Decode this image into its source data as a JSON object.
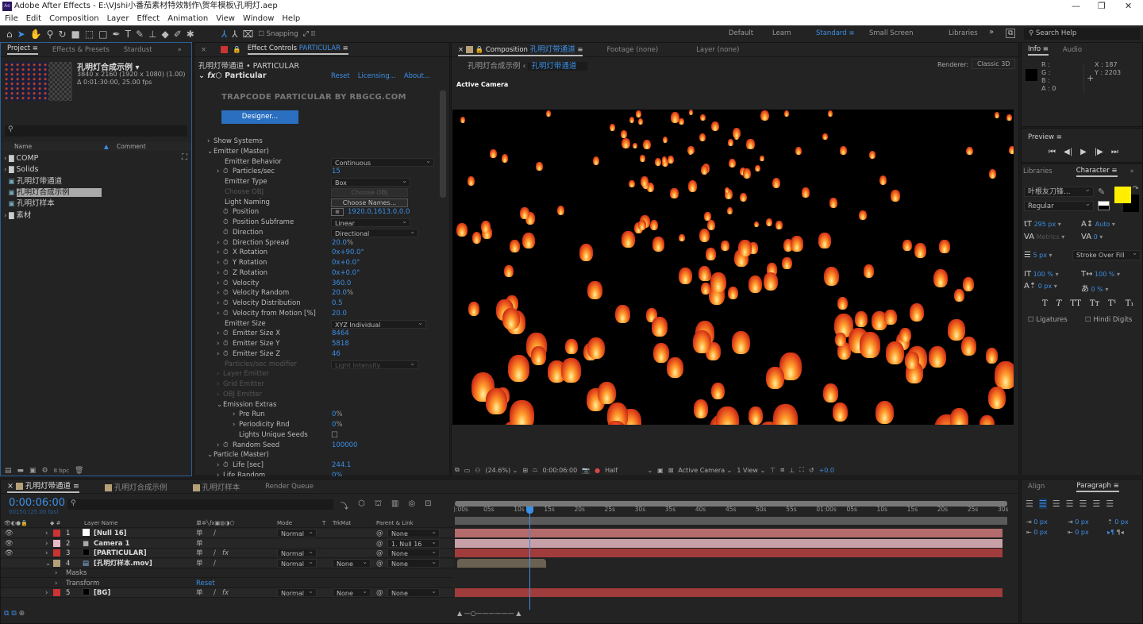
{
  "app": {
    "title": "Adobe After Effects - E:\\VJshi小番茄素材特效制作\\贺年模板\\孔明灯.aep",
    "logo": "Ae"
  },
  "menu": [
    "File",
    "Edit",
    "Composition",
    "Layer",
    "Effect",
    "Animation",
    "View",
    "Window",
    "Help"
  ],
  "toolbar": {
    "snapping": "Snapping",
    "workspaces": [
      "Default",
      "Learn",
      "Standard",
      "Small Screen",
      "Libraries"
    ],
    "active_workspace": "Standard",
    "search_placeholder": "Search Help"
  },
  "project": {
    "tabs": [
      "Project",
      "Effects & Presets",
      "Stardust"
    ],
    "comp_name": "孔明灯合成示例 ▾",
    "comp_size": "3840 x 2160  (1920 x 1080) (1.00)",
    "comp_duration": "Δ 0:01:30:00, 25.00 fps",
    "col_name": "Name",
    "col_comment": "Comment",
    "items": [
      {
        "name": "COMP",
        "type": "folder"
      },
      {
        "name": "Solids",
        "type": "folder"
      },
      {
        "name": "孔明灯带通道",
        "type": "comp"
      },
      {
        "name": "孔明灯合成示例",
        "type": "comp",
        "selected": true
      },
      {
        "name": "孔明灯样本",
        "type": "comp"
      },
      {
        "name": "素材",
        "type": "folder"
      }
    ],
    "bpc": "8 bpc"
  },
  "effect_controls": {
    "tab": "Effect Controls",
    "tab_layer": "PARTICULAR",
    "header": "孔明灯带通道 • PARTICULAR",
    "effect": "Particular",
    "links": [
      "Reset",
      "Licensing...",
      "About..."
    ],
    "brand": "TRAPCODE PARTICULAR BY RBGCG.COM",
    "designer": "Designer...",
    "rows": [
      {
        "label": "Show Systems",
        "ind": 0,
        "tw": ">"
      },
      {
        "label": "Emitter (Master)",
        "ind": 0,
        "tw": "v"
      },
      {
        "label": "Emitter Behavior",
        "ind": 2,
        "dd": "Continuous"
      },
      {
        "label": "Particles/sec",
        "ind": 1,
        "sw": true,
        "tw": ">",
        "val": "15"
      },
      {
        "label": "Emitter Type",
        "ind": 2,
        "dd": "Box"
      },
      {
        "label": "Choose OBJ",
        "ind": 2,
        "dis": true,
        "btn": "Choose OBJ"
      },
      {
        "label": "Light Naming",
        "ind": 2,
        "btn": "Choose Names..."
      },
      {
        "label": "Position",
        "ind": 1,
        "sw": true,
        "val": "1920.0,1613.0,0.0",
        "pos": true
      },
      {
        "label": "Position Subframe",
        "ind": 1,
        "sw": true,
        "dd": "Linear"
      },
      {
        "label": "Direction",
        "ind": 1,
        "sw": true,
        "dd": "Directional"
      },
      {
        "label": "Direction Spread",
        "ind": 1,
        "sw": true,
        "tw": ">",
        "val": "20.0",
        "unit": "%"
      },
      {
        "label": "X Rotation",
        "ind": 1,
        "sw": true,
        "tw": ">",
        "val": "0x+90.0°"
      },
      {
        "label": "Y Rotation",
        "ind": 1,
        "sw": true,
        "tw": ">",
        "val": "0x+0.0°"
      },
      {
        "label": "Z Rotation",
        "ind": 1,
        "sw": true,
        "tw": ">",
        "val": "0x+0.0°"
      },
      {
        "label": "Velocity",
        "ind": 1,
        "sw": true,
        "tw": ">",
        "val": "360.0"
      },
      {
        "label": "Velocity Random",
        "ind": 1,
        "sw": true,
        "tw": ">",
        "val": "20.0",
        "unit": "%"
      },
      {
        "label": "Velocity Distribution",
        "ind": 1,
        "sw": true,
        "tw": ">",
        "val": "0.5"
      },
      {
        "label": "Velocity from Motion [%]",
        "ind": 1,
        "sw": true,
        "tw": ">",
        "val": "20.0"
      },
      {
        "label": "Emitter Size",
        "ind": 2,
        "dd": "XYZ Individual"
      },
      {
        "label": "Emitter Size X",
        "ind": 1,
        "sw": true,
        "tw": ">",
        "val": "8464"
      },
      {
        "label": "Emitter Size Y",
        "ind": 1,
        "sw": true,
        "tw": ">",
        "val": "5818"
      },
      {
        "label": "Emitter Size Z",
        "ind": 1,
        "sw": true,
        "tw": ">",
        "val": "46"
      },
      {
        "label": "Particles/sec modifier",
        "ind": 2,
        "dis": true,
        "dd": "Light Intensity"
      },
      {
        "label": "Layer Emitter",
        "ind": 1,
        "dis": true,
        "tw": ">"
      },
      {
        "label": "Grid Emitter",
        "ind": 1,
        "dis": true,
        "tw": ">"
      },
      {
        "label": "OBJ Emitter",
        "ind": 1,
        "dis": true,
        "tw": ">"
      },
      {
        "label": "Emission Extras",
        "ind": 1,
        "tw": "v"
      },
      {
        "label": "Pre Run",
        "ind": 3,
        "tw": ">",
        "val": "0",
        "unit": "%"
      },
      {
        "label": "Periodicity Rnd",
        "ind": 3,
        "tw": ">",
        "val": "0",
        "unit": "%"
      },
      {
        "label": "Lights Unique Seeds",
        "ind": 3,
        "check": true
      },
      {
        "label": "Random Seed",
        "ind": 1,
        "sw": true,
        "tw": ">",
        "val": "100000"
      },
      {
        "label": "Particle (Master)",
        "ind": 0,
        "tw": "v"
      },
      {
        "label": "Life [sec]",
        "ind": 1,
        "sw": true,
        "tw": ">",
        "val": "244.1"
      },
      {
        "label": "Life Random",
        "ind": 1,
        "tw": ">",
        "val": "0%"
      }
    ]
  },
  "composition": {
    "tab_prefix": "Composition",
    "tab_name": "孔明灯带通道",
    "other_tabs": [
      "Footage (none)",
      "Layer (none)"
    ],
    "breadcrumb": [
      "孔明灯合成示例",
      "孔明灯带通道"
    ],
    "renderer_label": "Renderer:",
    "renderer": "Classic 3D",
    "camera_label": "Active Camera",
    "footer": {
      "zoom": "(24.6%)",
      "time": "0:00:06:00",
      "resolution": "Half",
      "camera": "Active Camera",
      "views": "1 View",
      "exposure": "+0.0"
    }
  },
  "info": {
    "tabs": [
      "Info",
      "Audio"
    ],
    "r": "R :",
    "g": "G :",
    "b": "B :",
    "a": "A : 0",
    "x": "X : 187",
    "y": "Y : 2203"
  },
  "preview": {
    "title": "Preview"
  },
  "character": {
    "tabs": [
      "Libraries",
      "Character"
    ],
    "font": "叶根友刀锋...",
    "style": "Regular",
    "fill_color": "#ffee00",
    "size": "295 px",
    "leading": "Auto",
    "kerning": "Metrics",
    "tracking": "0",
    "stroke": "5 px",
    "stroke_mode": "Stroke Over Fill",
    "vscale": "100 %",
    "hscale": "100 %",
    "baseline": "0 px",
    "tsume": "0 %",
    "styles": [
      "T",
      "T",
      "TT",
      "Tт",
      "T¹",
      "T₁"
    ],
    "ligatures": "Ligatures",
    "hindi": "Hindi Digits"
  },
  "paragraph": {
    "tabs": [
      "Align",
      "Paragraph"
    ],
    "indent_left": "0 px",
    "indent_right": "0 px",
    "space_before": "0 px",
    "space_after": "0 px",
    "first_line": "0 px"
  },
  "timeline": {
    "tabs": [
      "孔明灯带通道",
      "孔明灯合成示例",
      "孔明灯样本",
      "Render Queue"
    ],
    "timecode": "0:00:06:00",
    "frames": "00150 (25.00 fps)",
    "cols": {
      "name": "Layer Name",
      "mode": "Mode",
      "t": "T",
      "trkmat": "TrkMat",
      "parent": "Parent & Link"
    },
    "ticks": [
      "):00s",
      "05s",
      "10s",
      "15s",
      "20s",
      "25s",
      "30s",
      "35s",
      "40s",
      "45s",
      "50s",
      "55s",
      "01:00s",
      "05s",
      "10s",
      "15s",
      "20s",
      "25s",
      "30s"
    ],
    "playhead_sec": 6,
    "duration_sec": 90,
    "layers": [
      {
        "num": "1",
        "name": "[Null 16]",
        "label": "#cc3333",
        "icon": "null",
        "mode": "Normal",
        "trkmat": "",
        "parent": "None",
        "eye": true,
        "bar": "#b36b6b"
      },
      {
        "num": "2",
        "name": "Camera 1",
        "label": "#e8b8c8",
        "icon": "camera",
        "mode": "",
        "trkmat": "",
        "parent": "1. Null 16",
        "eye": true,
        "bar": "#c8a0a8"
      },
      {
        "num": "3",
        "name": "[PARTICULAR]",
        "label": "#cc3333",
        "icon": "solid",
        "mode": "Normal",
        "trkmat": "",
        "parent": "None",
        "eye": true,
        "fx": true,
        "bar": "#a03c3c"
      },
      {
        "num": "4",
        "name": "[孔明灯样本.mov]",
        "label": "#b5a07a",
        "icon": "footage",
        "mode": "Normal",
        "trkmat": "None",
        "parent": "None",
        "eye": false,
        "expanded": true,
        "bar": "#6b6152"
      },
      {
        "num": "5",
        "name": "[BG]",
        "label": "#cc3333",
        "icon": "solid",
        "mode": "Normal",
        "trkmat": "None",
        "parent": "None",
        "eye": false,
        "fx": true,
        "bar": "#a03c3c"
      }
    ],
    "sub": [
      "Masks",
      "Transform"
    ],
    "reset": "Reset"
  }
}
